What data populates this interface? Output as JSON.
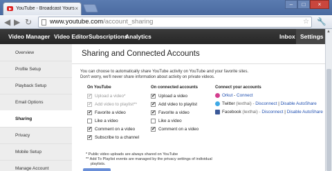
{
  "browser": {
    "tab_title": "YouTube - Broadcast Yours",
    "tab_close": "×",
    "url_host": "www.youtube.com",
    "url_path": "/account_sharing",
    "window_buttons": [
      "–",
      "□",
      "×"
    ],
    "back": "◀",
    "forward": "▶",
    "reload": "↻"
  },
  "ytnav": {
    "items": [
      "Video Manager",
      "Video Editor",
      "Subscriptions",
      "Analytics"
    ],
    "inbox": "Inbox",
    "settings": "Settings"
  },
  "sidebar": {
    "items": [
      "Overview",
      "Profile Setup",
      "Playback Setup",
      "Email Options",
      "Sharing",
      "Privacy",
      "Mobile Setup",
      "Manage Account"
    ],
    "active_index": 4
  },
  "main": {
    "title": "Sharing and Connected Accounts",
    "intro_line1": "You can choose to automatically share YouTube activity on YouTube and your favorite sites.",
    "intro_line2": "Don't worry, we'll never share information about activity on private videos.",
    "on_youtube": {
      "heading": "On YouTube",
      "items": [
        {
          "label": "Upload a video*",
          "checked": true,
          "disabled": true
        },
        {
          "label": "Add video to playlist**",
          "checked": true,
          "disabled": true
        },
        {
          "label": "Favorite a video",
          "checked": true,
          "disabled": false
        },
        {
          "label": "Like a video",
          "checked": false,
          "disabled": false
        },
        {
          "label": "Comment on a video",
          "checked": true,
          "disabled": false
        },
        {
          "label": "Subscribe to a channel",
          "checked": true,
          "disabled": false
        }
      ]
    },
    "connected": {
      "heading": "On connected accounts",
      "items": [
        {
          "label": "Upload a video",
          "checked": true
        },
        {
          "label": "Add video to playlist",
          "checked": true
        },
        {
          "label": "Favorite a video",
          "checked": true
        },
        {
          "label": "Like a video",
          "checked": false
        },
        {
          "label": "Comment on a video",
          "checked": true
        }
      ]
    },
    "accounts": {
      "heading": "Connect your accounts",
      "orkut_name": "Orkut",
      "orkut_sep": " - ",
      "orkut_connect": "Connect",
      "twitter_name": "Twitter",
      "twitter_user": " (lexthai) - ",
      "twitter_disconnect": "Disconnect",
      "twitter_sep": " | ",
      "twitter_disable": "Disable AutoShare",
      "facebook_name": "Facebook",
      "facebook_user": " (lexthai) - ",
      "facebook_disconnect": "Disconnect",
      "facebook_sep": " | ",
      "facebook_disable": "Disable AutoShare",
      "colors": {
        "orkut": "#d33e8e",
        "twitter": "#3fa9e6",
        "facebook": "#3b5998"
      }
    },
    "footnote1": "* Public video uploads are always shared on YouTube",
    "footnote2": "** Add To Playlist events are managed by the privacy settings of individual",
    "footnote3": "playlists."
  }
}
